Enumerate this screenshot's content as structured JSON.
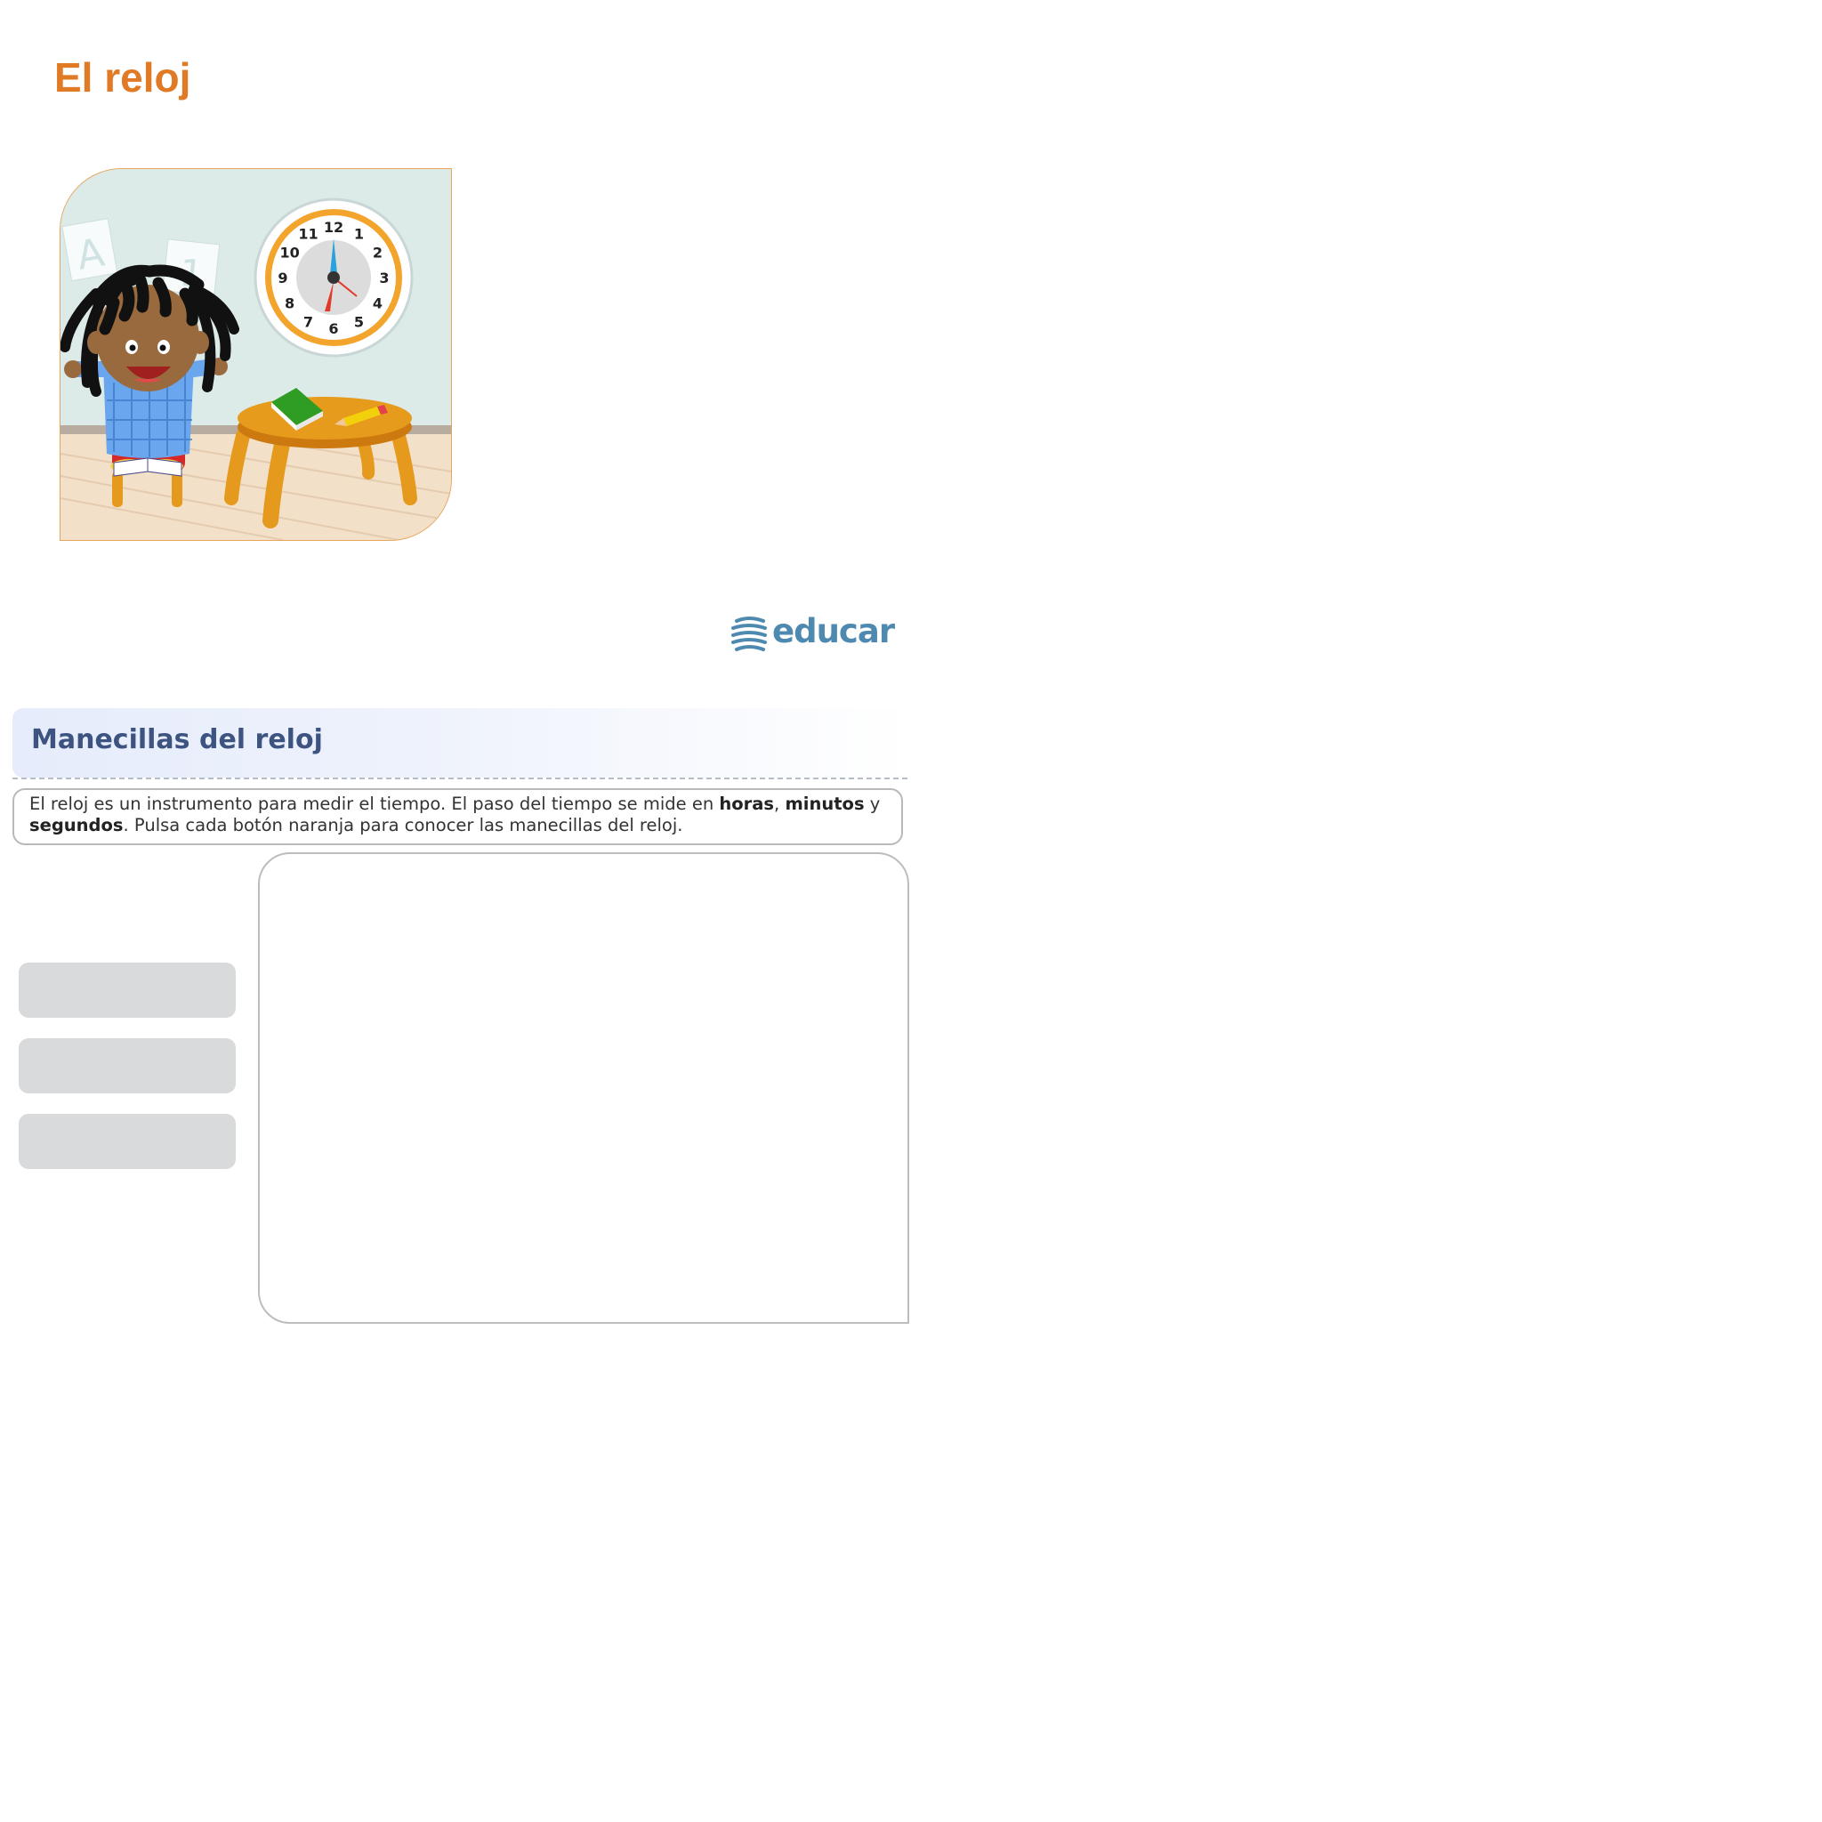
{
  "page": {
    "title": "El reloj"
  },
  "hero": {
    "clock_numbers": [
      "12",
      "1",
      "2",
      "3",
      "4",
      "5",
      "6",
      "7",
      "8",
      "9",
      "10",
      "11"
    ],
    "card_letter": "A",
    "card_number": "1"
  },
  "logo": {
    "text": "educar"
  },
  "section": {
    "title": "Manecillas del reloj",
    "instructions": {
      "part1": "El reloj es un instrumento para medir el tiempo. El paso del tiempo se mide en ",
      "hours": "horas",
      "comma": ", ",
      "minutes": "minutos",
      "and": " y",
      "seconds": "segundos",
      "part2": ". Pulsa cada botón naranja para conocer las manecillas del reloj."
    }
  },
  "buttons": [
    {
      "label": ""
    },
    {
      "label": ""
    },
    {
      "label": ""
    }
  ],
  "colors": {
    "title": "#e07a25",
    "section_title": "#3d5380",
    "button": "#d9dadc",
    "logo": "#4e8ab0"
  }
}
